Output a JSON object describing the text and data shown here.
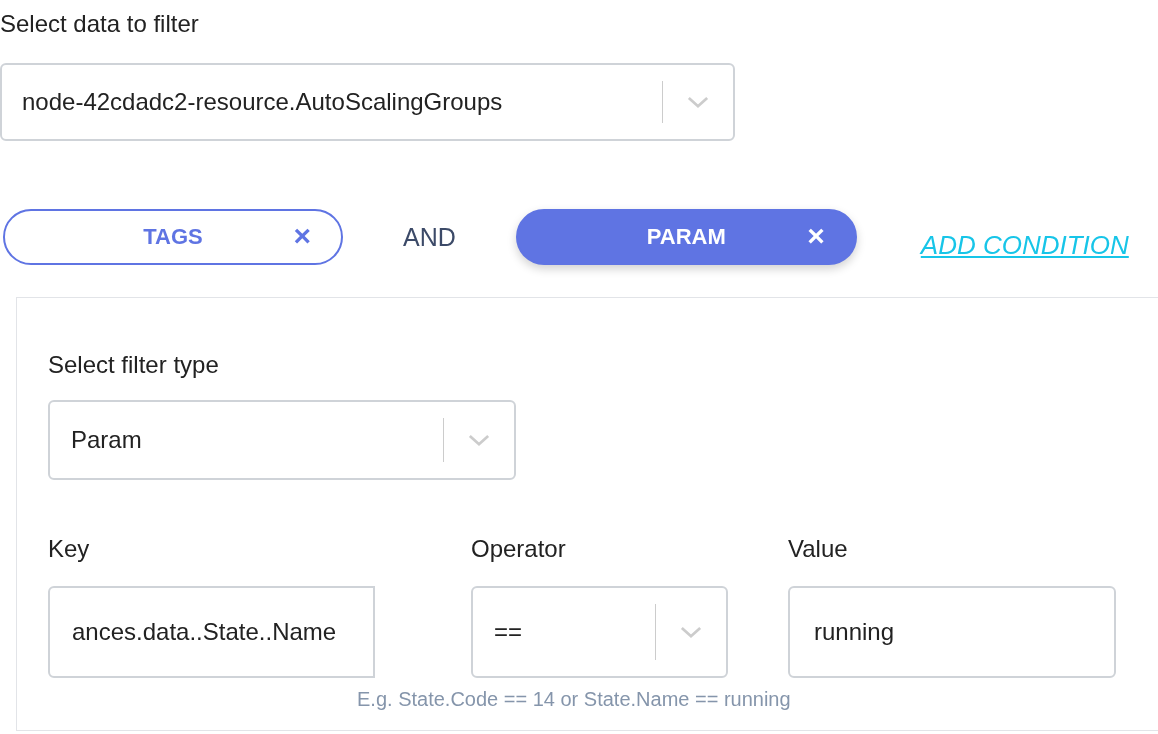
{
  "source": {
    "label": "Select data to filter",
    "value": "node-42cdadc2-resource.AutoScalingGroups"
  },
  "conditions": [
    {
      "label": "TAGS",
      "remove": "×",
      "selected": false
    },
    {
      "label": "PARAM",
      "remove": "×",
      "selected": true
    }
  ],
  "joiner": "AND",
  "add_condition": "ADD CONDITION",
  "filter": {
    "type_label": "Select filter type",
    "type_value": "Param",
    "fields": [
      {
        "kind": "input",
        "label": "Key",
        "value": "ances.data..State..Name"
      },
      {
        "kind": "select",
        "label": "Operator",
        "value": "=="
      },
      {
        "kind": "input",
        "label": "Value",
        "value": "running"
      }
    ],
    "hint": "E.g. State.Code == 14 or State.Name == running"
  }
}
